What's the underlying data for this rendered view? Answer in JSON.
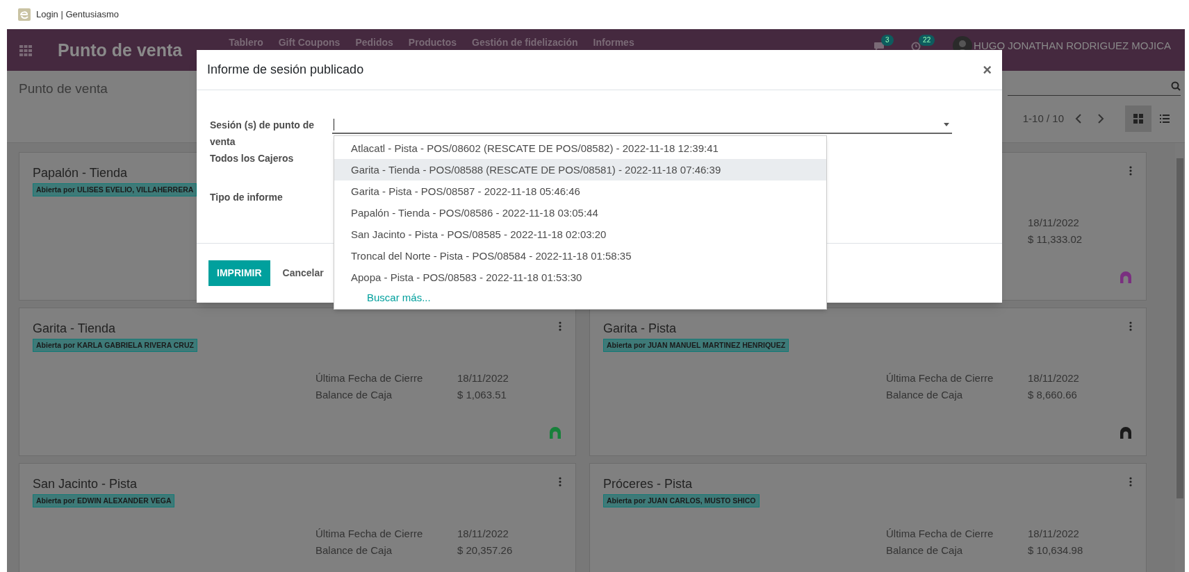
{
  "browser_tab": {
    "title": "Login | Gentusiasmo"
  },
  "navbar": {
    "app_name": "Punto de venta",
    "menu": [
      "Tablero",
      "Gift Coupons",
      "Pedidos",
      "Productos",
      "Gestión de fidelización",
      "Informes"
    ],
    "messages_count": "3",
    "activities_count": "22",
    "user": "HUGO JONATHAN RODRIGUEZ MOJICA"
  },
  "control_panel": {
    "title": "Punto de venta",
    "pager": "1-10 / 10",
    "views": [
      {
        "kind": "kanban",
        "selected": true
      },
      {
        "kind": "list",
        "selected": false
      }
    ]
  },
  "cards": [
    {
      "title": "Papalón - Tienda",
      "badge": "Abierta por ULISES EVELIO, VILLAHERRERA"
    },
    {
      "rows": [
        {
          "value": "18/11/2022"
        },
        {
          "value": "$ 11,333.02"
        }
      ],
      "color": "#7a2f80"
    },
    {
      "title": "Garita - Tienda",
      "badge": "Abierta por KARLA GABRIELA RIVERA CRUZ",
      "rows": [
        {
          "label": "Última Fecha de Cierre",
          "value": "18/11/2022"
        },
        {
          "label": "Balance de Caja",
          "value": "$ 1,063.51"
        }
      ],
      "color": "#17803a"
    },
    {
      "title": "Garita - Pista",
      "badge": "Abierta por JUAN MANUEL MARTINEZ HENRIQUEZ",
      "rows": [
        {
          "label": "Última Fecha de Cierre",
          "value": "18/11/2022"
        },
        {
          "label": "Balance de Caja",
          "value": "$ 8,660.66"
        }
      ],
      "color": "#1a1a1a"
    },
    {
      "title": "San Jacinto - Pista",
      "badge": "Abierta por EDWIN ALEXANDER VEGA",
      "rows": [
        {
          "label": "Última Fecha de Cierre",
          "value": "18/11/2022"
        },
        {
          "label": "Balance de Caja",
          "value": "$ 20,357.26"
        }
      ]
    },
    {
      "title": "Próceres - Pista",
      "badge": "Abierta por JUAN CARLOS, MUSTO SHICO",
      "rows": [
        {
          "label": "Última Fecha de Cierre",
          "value": "18/11/2022"
        },
        {
          "label": "Balance de Caja",
          "value": "$ 10,634.98"
        }
      ]
    }
  ],
  "dialog": {
    "title": "Informe de sesión publicado",
    "close": "×",
    "fields": [
      "Sesión (s) de punto de venta",
      "Todos los Cajeros",
      "Tipo de informe"
    ],
    "dropdown": {
      "options": [
        {
          "label": "Atlacatl - Pista - POS/08602 (RESCATE DE POS/08582) - 2022-11-18 12:39:41",
          "selected": false
        },
        {
          "label": "Garita - Tienda - POS/08588 (RESCATE DE POS/08581) - 2022-11-18 07:46:39",
          "selected": true
        },
        {
          "label": "Garita - Pista - POS/08587 - 2022-11-18 05:46:46",
          "selected": false
        },
        {
          "label": "Papalón - Tienda - POS/08586 - 2022-11-18 03:05:44",
          "selected": false
        },
        {
          "label": "San Jacinto - Pista - POS/08585 - 2022-11-18 02:03:20",
          "selected": false
        },
        {
          "label": "Troncal del Norte - Pista - POS/08584 - 2022-11-18 01:58:35",
          "selected": false
        },
        {
          "label": "Apopa - Pista - POS/08583 - 2022-11-18 01:53:30",
          "selected": false
        }
      ],
      "search_more": "Buscar más..."
    },
    "buttons": {
      "primary": "IMPRIMIR",
      "secondary": "Cancelar"
    }
  }
}
